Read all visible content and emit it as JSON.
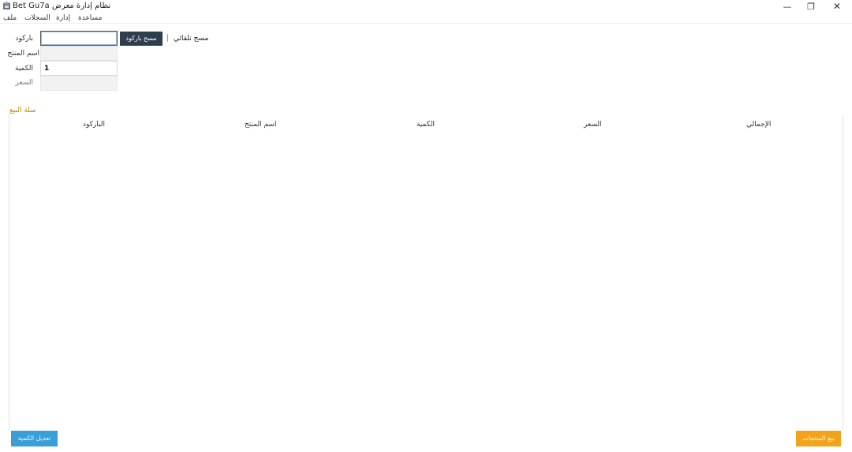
{
  "window": {
    "title": "Bet Gu7a نظام إدارة معرض",
    "minimize_glyph": "—",
    "maximize_glyph": "❐",
    "close_glyph": "✕"
  },
  "menu": {
    "items": [
      {
        "label": "ملف"
      },
      {
        "label": "السجلات"
      },
      {
        "label": "إدارة"
      },
      {
        "label": "مساعدة"
      }
    ]
  },
  "form": {
    "barcode_label": "باركود",
    "barcode_value": "",
    "scan_button": "مسح باركود",
    "continuous_scan_label": "مسح تلقائي",
    "product_name_label": "اسم المنتج",
    "product_name_value": "",
    "quantity_label": "الكمية",
    "quantity_value": "1",
    "price_label": "السعر",
    "price_value": ""
  },
  "cart": {
    "title": "سلة البيع",
    "columns": [
      "الباركود",
      "اسم المنتج",
      "الكمية",
      "السعر",
      "الإجمالي"
    ],
    "rows": []
  },
  "actions": {
    "edit_quantity": "تعديل الكمية",
    "complete_sale": "بيع المنتجات"
  },
  "colors": {
    "scan_button_bg": "#2f3e4f",
    "edit_button_bg": "#3a9fd8",
    "complete_button_bg": "#f2a31b",
    "cart_title": "#c28a00"
  },
  "icons": {
    "app": "app-icon",
    "minimize": "minimize-icon",
    "maximize": "maximize-icon",
    "close": "close-icon"
  }
}
